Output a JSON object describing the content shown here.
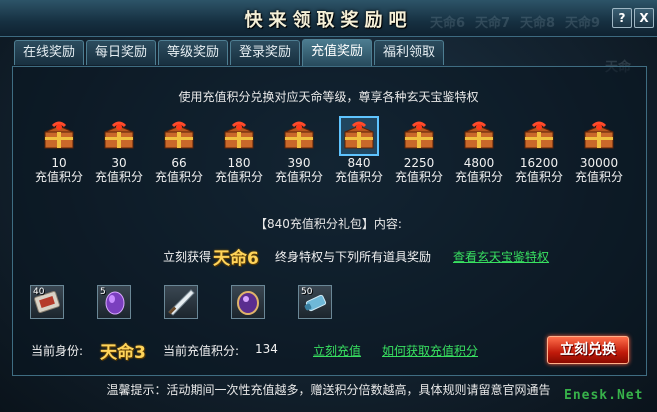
{
  "window": {
    "title": "快来领取奖励吧",
    "help_label": "?",
    "close_label": "X",
    "background_ghost_text": [
      "天命6",
      "天命7",
      "天命8",
      "天命9",
      "天命"
    ]
  },
  "tabs": [
    {
      "label": "在线奖励",
      "active": false
    },
    {
      "label": "每日奖励",
      "active": false
    },
    {
      "label": "等级奖励",
      "active": false
    },
    {
      "label": "登录奖励",
      "active": false
    },
    {
      "label": "充值奖励",
      "active": true
    },
    {
      "label": "福利领取",
      "active": false
    }
  ],
  "header_text": "使用充值积分兑换对应天命等级，尊享各种玄天宝鉴特权",
  "tiers": [
    {
      "value": "10",
      "unit": "充值积分",
      "selected": false
    },
    {
      "value": "30",
      "unit": "充值积分",
      "selected": false
    },
    {
      "value": "66",
      "unit": "充值积分",
      "selected": false
    },
    {
      "value": "180",
      "unit": "充值积分",
      "selected": false
    },
    {
      "value": "390",
      "unit": "充值积分",
      "selected": false
    },
    {
      "value": "840",
      "unit": "充值积分",
      "selected": true
    },
    {
      "value": "2250",
      "unit": "充值积分",
      "selected": false
    },
    {
      "value": "4800",
      "unit": "充值积分",
      "selected": false
    },
    {
      "value": "16200",
      "unit": "充值积分",
      "selected": false
    },
    {
      "value": "30000",
      "unit": "充值积分",
      "selected": false
    }
  ],
  "pack_title": "【840充值积分礼包】内容:",
  "reward": {
    "gain_label": "立刻获得",
    "rank": "天命6",
    "description": "终身特权与下列所有道具奖励",
    "link": "查看玄天宝鉴特权"
  },
  "items": [
    {
      "icon": "ticket-icon",
      "count": "40"
    },
    {
      "icon": "purple-egg-icon",
      "count": "5"
    },
    {
      "icon": "blade-icon",
      "count": ""
    },
    {
      "icon": "purple-gem-icon",
      "count": ""
    },
    {
      "icon": "scroll-icon",
      "count": "50"
    }
  ],
  "status": {
    "identity_label": "当前身份:",
    "identity_rank": "天命3",
    "points_label": "当前充值积分:",
    "points_value": "134",
    "recharge_link": "立刻充值",
    "howto_link": "如何获取充值积分",
    "redeem_button": "立刻兑换"
  },
  "tip": "温馨提示：活动期间一次性充值越多，赠送积分倍数越高，具体规则请留意官网通告",
  "watermark": "Enesk.Net",
  "colors": {
    "accent_green": "#38e060",
    "gold": "#ffd45a",
    "redeem_red": "#c01a0a",
    "selection_blue": "#5fc4ff"
  }
}
